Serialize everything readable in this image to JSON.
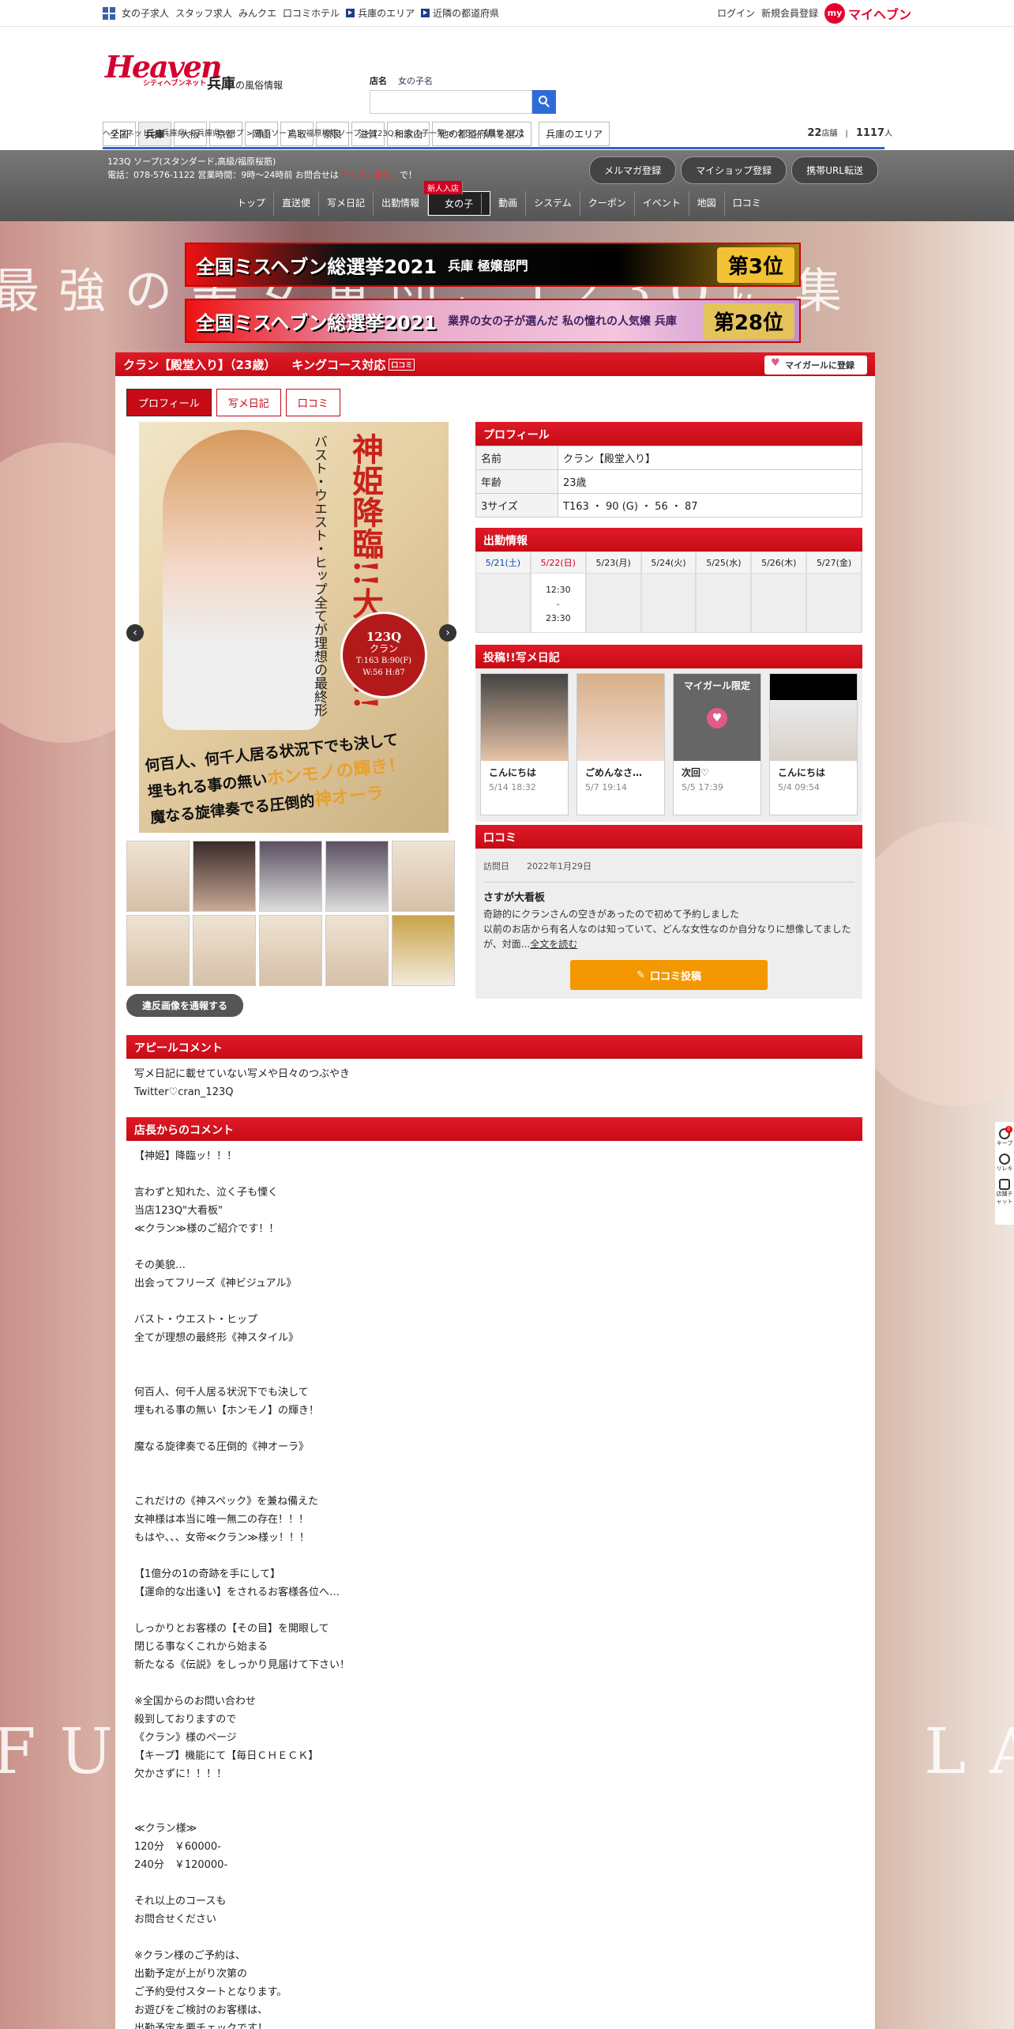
{
  "topbar": {
    "links": [
      "女の子求人",
      "スタッフ求人",
      "みんクエ",
      "口コミホテル"
    ],
    "area_links": [
      "兵庫のエリア",
      "近隣の都道府県"
    ],
    "login": "ログイン",
    "register": "新規会員登録",
    "my_label": "my",
    "my_heaven": "マイヘブン"
  },
  "header": {
    "logo_text": "Heaven",
    "logo_small": "シティヘブンネット",
    "pref": "兵庫",
    "pref_suffix": "の風俗情報",
    "search_tabs": [
      "店名",
      "女の子名"
    ],
    "search_placeholder": "",
    "areas": [
      "全国",
      "兵庫",
      "大阪",
      "京都",
      "岡山",
      "鳥取",
      "奈良",
      "滋賀",
      "和歌山",
      "他の都道府県を選ぶ",
      "兵庫のエリア"
    ]
  },
  "breadcrumb": {
    "path": "ヘブンネット > 兵庫県 > 兵庫県ソープ > 福原ソープ > 福原桜筋ソープ > 123Q > 女の子一覧 > クラン【殿堂入り】",
    "shops": "22",
    "shops_unit": "店舗",
    "people": "1117",
    "people_unit": "人"
  },
  "shop": {
    "line1": "123Q ソープ(スタンダード,高級/福原桜筋)",
    "line2": "電話：078-576-1122 営業時間：9時〜24時前 お問合せは",
    "line2_red": "「ヘブン見た」",
    "line2_end": "で！",
    "buttons": [
      "メルマガ登録",
      "マイショップ登録",
      "携帯URL転送"
    ],
    "nav": [
      "トップ",
      "直送便",
      "写メ日記",
      "出勤情報",
      "女の子",
      "動画",
      "システム",
      "クーポン",
      "イベント",
      "地図",
      "口コミ"
    ],
    "new_badge": "新人入店"
  },
  "background": {
    "top_text": "最強の美女軍団、123Qに集",
    "fu": "FU",
    "la": "LA"
  },
  "banners": [
    {
      "a": "全国ミスヘブン総選挙2021",
      "b": "兵庫 極嬢部門",
      "c": "第3位"
    },
    {
      "a": "全国ミスヘブン総選挙2021",
      "b": "業界の女の子が選んだ 私の憧れの人気嬢 兵庫",
      "c": "第28位"
    }
  ],
  "girl": {
    "title": "クラン【殿堂入り】（23歳）",
    "course": "キングコース対応",
    "course_tag": "口コミ",
    "mygirl": "マイガールに登録",
    "tabs": [
      "プロフィール",
      "写メ日記",
      "口コミ"
    ],
    "image": {
      "headline": "神姫降臨!!大看板!!",
      "subline": "バスト・ウエスト・ヒップ全てが理想の最終形",
      "circle_logo": "123Q",
      "circle_name": "クラン",
      "circle_size1": "T:163 B:90(F)",
      "circle_size2": "W:56 H:87",
      "caption1": "何百人、何千人居る状況下でも決して",
      "caption2": "埋もれる事の無い",
      "caption2b": "ホンモノの輝き！",
      "caption3": "魔なる旋律奏でる圧倒的",
      "caption3b": "神オーラ"
    },
    "report": "違反画像を通報する"
  },
  "profile": {
    "heading": "プロフィール",
    "rows": [
      {
        "k": "名前",
        "v": "クラン【殿堂入り】"
      },
      {
        "k": "年齢",
        "v": "23歳"
      },
      {
        "k": "3サイズ",
        "v": "T163 ・ 90 (G) ・ 56 ・ 87"
      }
    ]
  },
  "schedule": {
    "heading": "出勤情報",
    "days": [
      "5/21(土)",
      "5/22(日)",
      "5/23(月)",
      "5/24(火)",
      "5/25(水)",
      "5/26(木)",
      "5/27(金)"
    ],
    "times": [
      "",
      "12:30\n-\n23:30",
      "",
      "",
      "",
      "",
      ""
    ]
  },
  "diary": {
    "heading": "投稿!!写メ日記",
    "entries": [
      {
        "title": "こんにちは",
        "date": "5/14 18:32"
      },
      {
        "title": "ごめんなさ…",
        "date": "5/7 19:14"
      },
      {
        "title": "次回♡",
        "date": "5/5 17:39",
        "label": "マイガール限定"
      },
      {
        "title": "こんにちは",
        "date": "5/4 09:54"
      }
    ]
  },
  "review": {
    "heading": "口コミ",
    "visit_label": "訪問日",
    "visit_date": "2022年1月29日",
    "title": "さすが大看板",
    "body": "奇跡的にクランさんの空きがあったので初めて予約しました\n以前のお店から有名人なのは知っていて、どんな女性なのか自分なりに想像してましたが、対面...",
    "more": "全文を読む",
    "button": "口コミ投稿"
  },
  "appeal": {
    "heading": "アピールコメント",
    "body": "写メ日記に載せていない写メや日々のつぶやき\nTwitter♡cran_123Q"
  },
  "manager": {
    "heading": "店長からのコメント",
    "body": "【神姫】降臨ッ！！！\n\n言わずと知れた、泣く子も慄く\n当店123Q\"大看板\"\n≪クラン≫様のご紹介です！！\n\nその美貌…\n出会ってフリーズ《神ビジュアル》\n\nバスト・ウエスト・ヒップ\n全てが理想の最終形《神スタイル》\n\n\n何百人、何千人居る状況下でも決して\n埋もれる事の無い【ホンモノ】の輝き！\n\n魔なる旋律奏でる圧倒的《神オーラ》\n\n\nこれだけの《神スペック》を兼ね備えた\n女神様は本当に唯一無二の存在！！！\nもはや、、、女帝≪クラン≫様ッ！！！\n\n【1億分の1の奇跡を手にして】\n【運命的な出逢い】をされるお客様各位へ…\n\nしっかりとお客様の【その目】を開眼して\n閉じる事なくこれから始まる\n新たなる《伝説》をしっかり見届けて下さい！\n\n※全国からのお問い合わせ\n殺到しておりますので\n《クラン》様のページ\n【キープ】機能にて【毎日ＣＨＥＣＫ】\n欠かさずに！！！！\n\n\n≪クラン様≫\n120分　￥60000-\n240分　￥120000-\n\nそれ以上のコースも\nお問合せください\n\n※クラン様のご予約は、\n出勤予定が上がり次第の\nご予約受付スタートとなります。\nお遊びをご検討のお客様は、\n出勤予定を要チェックです！"
  },
  "side": {
    "keep": "キープ",
    "history": "リレキ",
    "chat": "店舗チャット",
    "badge": "0"
  }
}
